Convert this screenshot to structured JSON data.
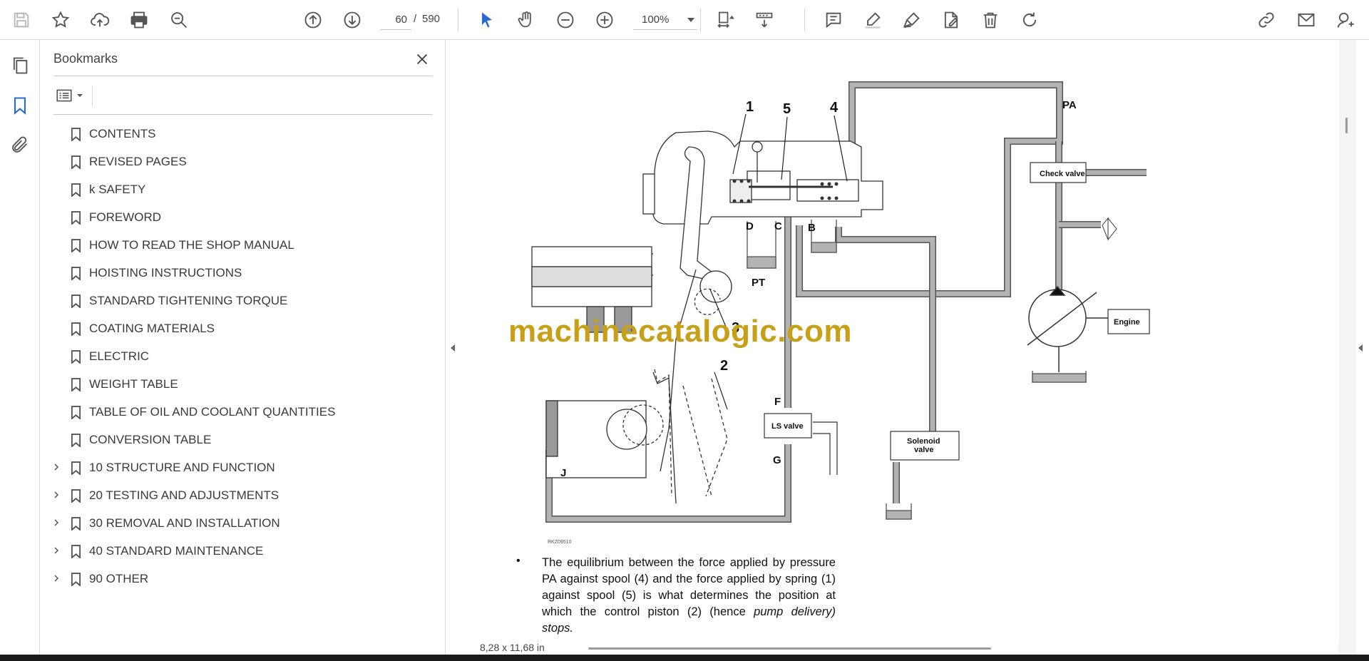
{
  "toolbar": {
    "page_current": "60",
    "page_separator": "/",
    "page_total": "590",
    "zoom": "100%"
  },
  "bookmarks": {
    "title": "Bookmarks",
    "items": [
      {
        "label": "CONTENTS",
        "expandable": false
      },
      {
        "label": "REVISED PAGES",
        "expandable": false
      },
      {
        "label": "k SAFETY",
        "expandable": false
      },
      {
        "label": "FOREWORD",
        "expandable": false
      },
      {
        "label": "HOW TO READ THE SHOP MANUAL",
        "expandable": false
      },
      {
        "label": "HOISTING INSTRUCTIONS",
        "expandable": false
      },
      {
        "label": "STANDARD TIGHTENING TORQUE",
        "expandable": false
      },
      {
        "label": "COATING MATERIALS",
        "expandable": false
      },
      {
        "label": "ELECTRIC",
        "expandable": false
      },
      {
        "label": "WEIGHT TABLE",
        "expandable": false
      },
      {
        "label": "TABLE OF OIL AND COOLANT QUANTITIES",
        "expandable": false
      },
      {
        "label": "CONVERSION TABLE",
        "expandable": false
      },
      {
        "label": "10 STRUCTURE AND FUNCTION",
        "expandable": true
      },
      {
        "label": "20 TESTING AND ADJUSTMENTS",
        "expandable": true
      },
      {
        "label": "30 REMOVAL AND INSTALLATION",
        "expandable": true
      },
      {
        "label": "40 STANDARD MAINTENANCE",
        "expandable": true
      },
      {
        "label": "90 OTHER",
        "expandable": true
      }
    ]
  },
  "document": {
    "diagram_labels": {
      "n1": "1",
      "n2": "2",
      "n3": "3",
      "n4": "4",
      "n5": "5",
      "pa": "PA",
      "pt": "PT",
      "b": "B",
      "c": "C",
      "d": "D",
      "f": "F",
      "g": "G",
      "j": "J",
      "check_valve": "Check valve",
      "engine": "Engine",
      "ls_valve": "LS valve",
      "solenoid_line1": "Solenoid",
      "solenoid_line2": "valve",
      "figure_code": "RKZ09510"
    },
    "watermark": "machinecatalogic.com",
    "paragraph_part1": "The equilibrium between the force applied by pressure PA against spool (4) and the force applied by spring (1) against spool (5) is what determines the position at which the control piston (2) (hence",
    "paragraph_italic": "pump delivery) stops.",
    "page_size": "8,28 x 11,68 in"
  },
  "colors": {
    "accent_blue": "#2a6bd3",
    "watermark_gold": "#c8a018",
    "pipe_grey": "#b3b3b3",
    "pipe_outline": "#555555"
  }
}
